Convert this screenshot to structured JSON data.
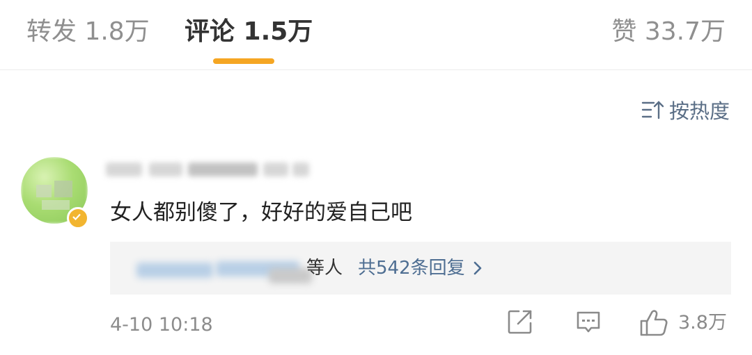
{
  "tabs": {
    "repost_label": "转发 1.8万",
    "comments_label": "评论 1.5万",
    "likes_label": "赞 33.7万",
    "active": "comments"
  },
  "sort": {
    "label": "按热度",
    "icon": "sort-icon"
  },
  "comment": {
    "text": "女人都别傻了，好好的爱自己吧",
    "timestamp": "4-10 10:18",
    "replies": {
      "others_suffix": "等人",
      "count_label": "共542条回复"
    },
    "like_count": "3.8万"
  },
  "colors": {
    "accent": "#f5a623",
    "link": "#4e6e92",
    "verified_badge": "#f2b530"
  }
}
